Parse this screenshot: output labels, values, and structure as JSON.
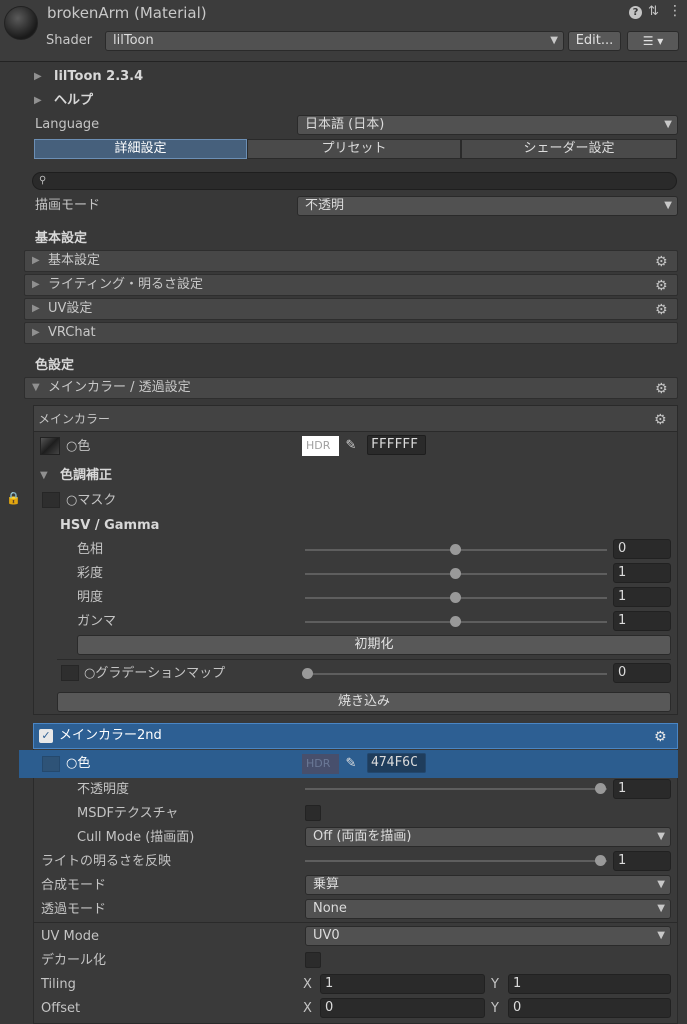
{
  "window": {
    "title": "brokenArm (Material)",
    "shader_label": "Shader",
    "shader_value": "lilToon",
    "edit_button": "Edit...",
    "help_icon": "?",
    "menu_icon": "⋮"
  },
  "sections": {
    "liltoon_version": "lilToon 2.3.4",
    "help": "ヘルプ",
    "language_label": "Language",
    "language_value": "日本語 (日本)"
  },
  "tabs": [
    "詳細設定",
    "プリセット",
    "シェーダー設定"
  ],
  "search": {
    "placeholder": ""
  },
  "render_mode": {
    "label": "描画モード",
    "value": "不透明"
  },
  "basic": {
    "heading": "基本設定",
    "foldouts": [
      "基本設定",
      "ライティング・明るさ設定",
      "UV設定",
      "VRChat"
    ]
  },
  "color": {
    "heading": "色設定",
    "main_foldout": "メインカラー / 透過設定",
    "main_color_box": "メインカラー",
    "color_label": "○色",
    "hdr": "HDR",
    "hex1": "FFFFFF",
    "tone_correction": "色調補正",
    "mask_label": "○マスク",
    "hsv_heading": "HSV / Gamma",
    "sliders": [
      {
        "label": "色相",
        "value": "0",
        "pos": 0.5
      },
      {
        "label": "彩度",
        "value": "1",
        "pos": 0.5
      },
      {
        "label": "明度",
        "value": "1",
        "pos": 0.5
      },
      {
        "label": "ガンマ",
        "value": "1",
        "pos": 0.5
      }
    ],
    "reset_button": "初期化",
    "gradation_label": "○グラデーションマップ",
    "gradation_value": "0",
    "bake_button": "焼き込み"
  },
  "main2": {
    "title": "メインカラー2nd",
    "color_label": "○色",
    "hdr": "HDR",
    "hex": "474F6C",
    "opacity_label": "不透明度",
    "opacity_value": "1",
    "msdf_label": "MSDFテクスチャ",
    "cull_label": "Cull Mode (描画面)",
    "cull_value": "Off (両面を描画)",
    "light_label": "ライトの明るさを反映",
    "light_value": "1",
    "blend_label": "合成モード",
    "blend_value": "乗算",
    "trans_label": "透過モード",
    "trans_value": "None",
    "uvmode_label": "UV Mode",
    "uvmode_value": "UV0",
    "decal_label": "デカール化",
    "tiling_label": "Tiling",
    "tiling_x": "1",
    "tiling_y": "1",
    "offset_label": "Offset",
    "offset_x": "0",
    "offset_y": "0",
    "x_label": "X",
    "y_label": "Y"
  }
}
